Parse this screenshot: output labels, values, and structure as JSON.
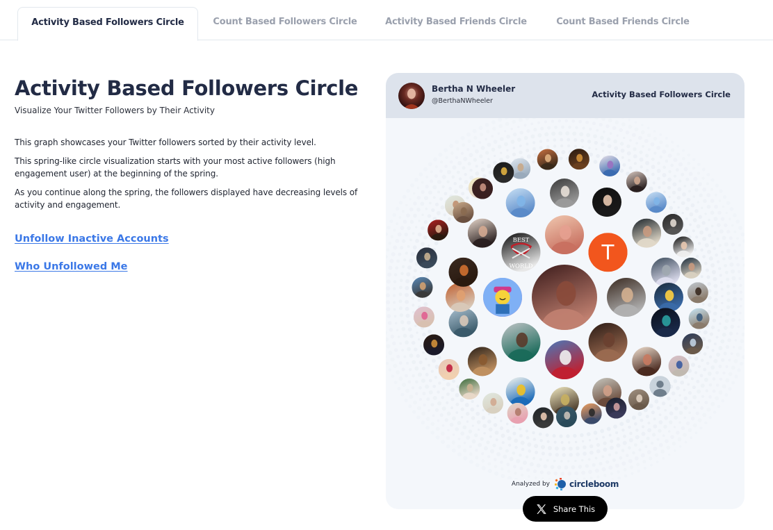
{
  "tabs": [
    {
      "label": "Activity Based Followers Circle",
      "active": true
    },
    {
      "label": "Count Based Followers Circle",
      "active": false
    },
    {
      "label": "Activity Based Friends Circle",
      "active": false
    },
    {
      "label": "Count Based Friends Circle",
      "active": false
    }
  ],
  "main": {
    "title": "Activity Based Followers Circle",
    "subtitle": "Visualize Your Twitter Followers by Their Activity",
    "paragraphs": [
      "This graph showcases your Twitter followers sorted by their activity level.",
      "This spring-like circle visualization starts with your most active followers (high engagement user) at the beginning of the spring.",
      "As you continue along the spring, the followers displayed have decreasing levels of activity and engagement."
    ],
    "links": [
      {
        "label": "Unfollow Inactive Accounts"
      },
      {
        "label": "Who Unfollowed Me"
      }
    ]
  },
  "card": {
    "owner_name": "Bertha N Wheeler",
    "owner_handle": "@BerthaNWheeler",
    "label": "Activity Based Followers Circle",
    "analyzed_by": "Analyzed by",
    "brand": "circleboom",
    "share_label": "Share This",
    "share_icon": "x-logo-icon"
  },
  "colors": {
    "accent_link": "#3b78e7",
    "title": "#222b45",
    "card_bg": "#f4f7fb",
    "card_header_bg": "#dde3ec",
    "t_avatar": "#f2561d"
  },
  "avatars": {
    "center": {
      "kind": "photo",
      "tone": [
        "#3a1a1a",
        "#8a4a3a",
        "#c08070"
      ],
      "label": "Bertha N Wheeler"
    },
    "inner": [
      {
        "kind": "logo",
        "tone": [
          "#0b0b0b",
          "#c0202a",
          "#e8e8e8"
        ],
        "text": "BEST WORLD"
      },
      {
        "kind": "photo",
        "tone": [
          "#f0c8b0",
          "#e6a090",
          "#c87060"
        ]
      },
      {
        "kind": "letter",
        "tone": [
          "#f2561d"
        ],
        "text": "T"
      },
      {
        "kind": "cartoon",
        "tone": [
          "#7fb0f5",
          "#f6d23a",
          "#d03a8a"
        ]
      },
      {
        "kind": "photo",
        "tone": [
          "#3a2a20",
          "#d4b090",
          "#b0b0b0"
        ]
      },
      {
        "kind": "photo",
        "tone": [
          "#c0c4c6",
          "#5a3a2a",
          "#1a6a5a"
        ]
      },
      {
        "kind": "photo",
        "tone": [
          "#4a78b8",
          "#f0f0f0",
          "#c02030"
        ]
      },
      {
        "kind": "photo",
        "tone": [
          "#2a1a14",
          "#6a4030",
          "#9a6a50"
        ]
      }
    ],
    "middle_count": 16,
    "outer_count": 33
  }
}
